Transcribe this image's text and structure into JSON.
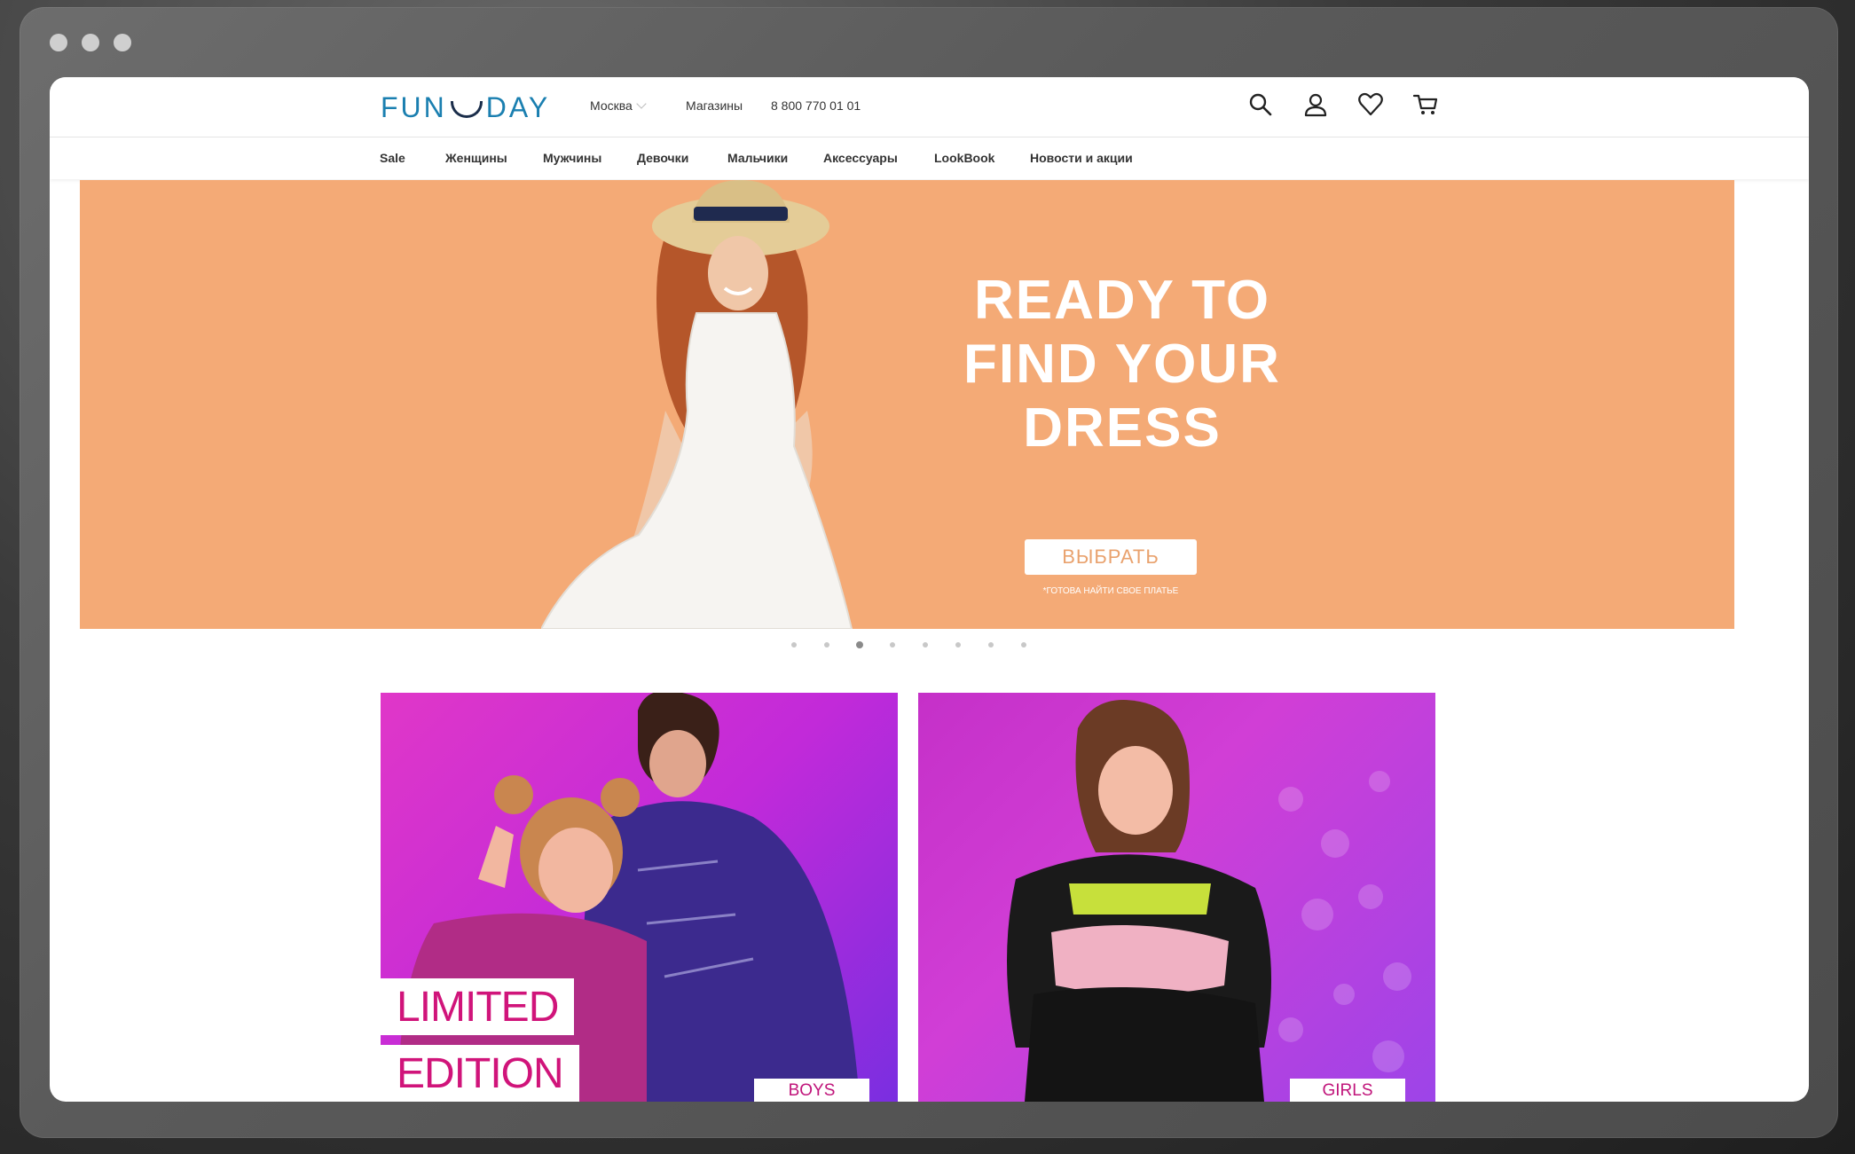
{
  "header": {
    "logo_left": "FUN",
    "logo_right": "DAY",
    "city": "Москва",
    "stores": "Магазины",
    "phone": "8 800 770 01 01"
  },
  "nav": {
    "items": [
      "Sale",
      "Женщины",
      "Мужчины",
      "Девочки",
      "Мальчики",
      "Аксессуары",
      "LookBook",
      "Новости и акции"
    ]
  },
  "hero": {
    "title_line1": "READY TO",
    "title_line2": "FIND YOUR",
    "title_line3": "DRESS",
    "button_label": "ВЫБРАТЬ",
    "note": "*ГОТОВА НАЙТИ СВОЕ ПЛАТЬЕ",
    "slide_count": 8,
    "active_slide": 3
  },
  "tiles": {
    "left_badge_line1": "LIMITED",
    "left_badge_line2": "EDITION",
    "left_tag": "BOYS",
    "right_tag": "GIRLS"
  },
  "colors": {
    "hero_bg": "#f4aa76",
    "brand_blue": "#1a7fb0",
    "accent_pink": "#d0147a"
  },
  "icons": [
    "search-icon",
    "user-icon",
    "heart-icon",
    "cart-icon"
  ]
}
